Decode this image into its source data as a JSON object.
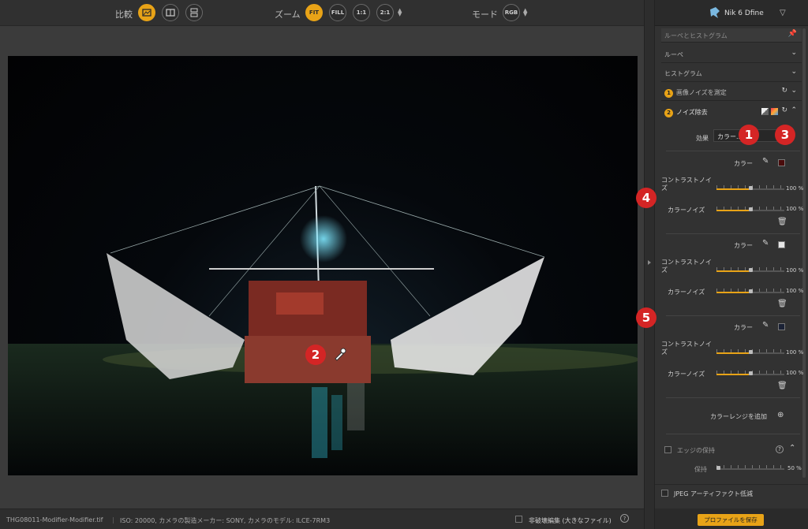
{
  "toolbar": {
    "compare_label": "比較",
    "zoom_label": "ズーム",
    "zoom_options": [
      "FIT",
      "FILL",
      "1:1",
      "2:1"
    ],
    "mode_label": "モード",
    "mode_value": "RGB"
  },
  "panel": {
    "brand": "Nik 6 Dfine",
    "sections": {
      "loupe_hist": "ルーペとヒストグラム",
      "loupe": "ルーペ",
      "histogram": "ヒストグラム",
      "measure": "画像ノイズを測定",
      "measure_num": "1",
      "reduce": "ノイズ除去",
      "reduce_num": "2",
      "edge": "エッジの保持",
      "jpeg": "JPEG アーティファクト低減"
    },
    "effect_label": "効果",
    "effect_value": "カラー...",
    "ranges": [
      {
        "label": "カラー",
        "contrast_label": "コントラストノイズ",
        "contrast_value": "100 %",
        "color_noise_label": "カラーノイズ",
        "color_noise_value": "100 %",
        "swatch": "#4a0c0c"
      },
      {
        "label": "カラー",
        "contrast_label": "コントラストノイズ",
        "contrast_value": "100 %",
        "color_noise_label": "カラーノイズ",
        "color_noise_value": "100 %",
        "swatch": "#e6e6e6"
      },
      {
        "label": "カラー",
        "contrast_label": "コントラストノイズ",
        "contrast_value": "100 %",
        "color_noise_label": "カラーノイズ",
        "color_noise_value": "100 %",
        "swatch": "#1b2236"
      }
    ],
    "add_range": "カラーレンジを追加",
    "preserve_label": "保持",
    "preserve_value": "50 %",
    "save_button": "プロファイルを保存"
  },
  "status": {
    "filename": "THG08011-Modifier-Modifier.tif",
    "info": "ISO: 20000, カメラの製造メーカー: SONY, カメラのモデル: ILCE-7RM3",
    "nondestructive": "非破壊編集 (大きなファイル)"
  },
  "annotations": [
    "1",
    "2",
    "3",
    "4",
    "5"
  ],
  "colors": {
    "accent": "#e8a317",
    "annotation": "#d42525"
  }
}
